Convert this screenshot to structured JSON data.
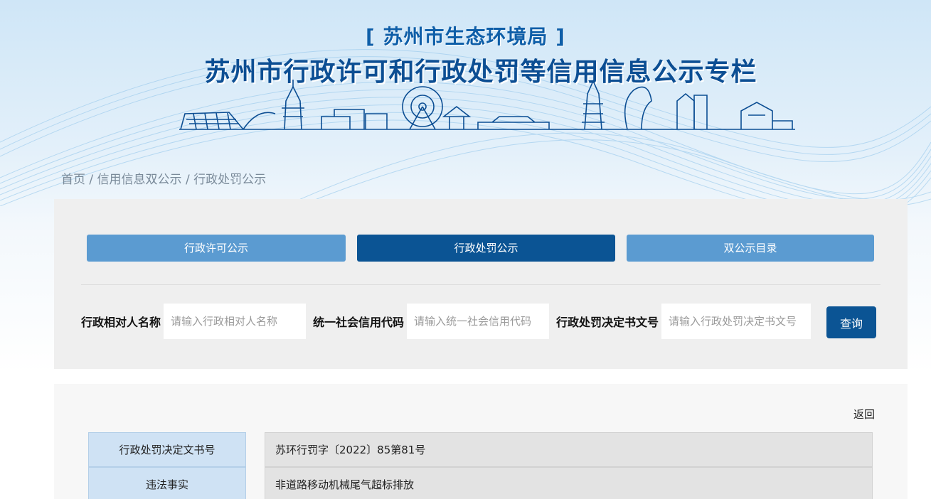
{
  "header": {
    "org_name": "[ 苏州市生态环境局 ]",
    "title": "苏州市行政许可和行政处罚等信用信息公示专栏"
  },
  "breadcrumb": {
    "home": "首页",
    "sep": " / ",
    "level2": "信用信息双公示",
    "level3": "行政处罚公示"
  },
  "tabs": [
    {
      "label": "行政许可公示",
      "active": false
    },
    {
      "label": "行政处罚公示",
      "active": true
    },
    {
      "label": "双公示目录",
      "active": false
    }
  ],
  "search": {
    "name_label": "行政相对人名称",
    "name_placeholder": "请输入行政相对人名称",
    "code_label": "统一社会信用代码",
    "code_placeholder": "请输入统一社会信用代码",
    "doc_label": "行政处罚决定书文号",
    "doc_placeholder": "请输入行政处罚决定书文号",
    "button": "查询"
  },
  "detail": {
    "back": "返回",
    "rows": [
      {
        "key": "行政处罚决定文书号",
        "value": "苏环行罚字〔2022〕85第81号"
      },
      {
        "key": "违法事实",
        "value": "非道路移动机械尾气超标排放"
      }
    ]
  },
  "colors": {
    "primary_dark": "#0b5494",
    "primary_light": "#5b9bd1",
    "title_blue": "#0c4e93"
  }
}
